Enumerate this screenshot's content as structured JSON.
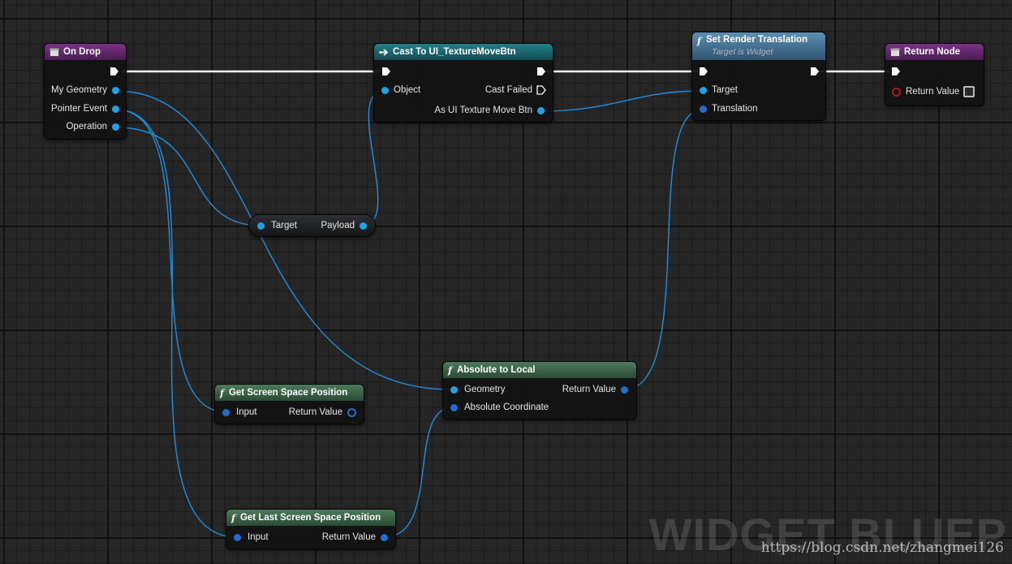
{
  "nodes": {
    "on_drop": {
      "title": "On Drop",
      "pins": [
        "My Geometry",
        "Pointer Event",
        "Operation"
      ]
    },
    "cast": {
      "title": "Cast To UI_TextureMoveBtn",
      "object": "Object",
      "cast_failed": "Cast Failed",
      "as_btn": "As UI Texture Move Btn"
    },
    "set_render": {
      "title": "Set Render Translation",
      "subtitle": "Target is Widget",
      "target": "Target",
      "translation": "Translation"
    },
    "return_node": {
      "title": "Return Node",
      "return_value": "Return Value"
    },
    "payload": {
      "target": "Target",
      "payload": "Payload"
    },
    "abs_to_local": {
      "title": "Absolute to Local",
      "geometry": "Geometry",
      "abs_coord": "Absolute Coordinate",
      "return_value": "Return Value"
    },
    "screen_pos": {
      "title": "Get Screen Space Position",
      "input": "Input",
      "return_value": "Return Value"
    },
    "last_screen_pos": {
      "title": "Get Last Screen Space Position",
      "input": "Input",
      "return_value": "Return Value"
    }
  },
  "watermark": {
    "title": "WIDGET BLUEP",
    "url": "https://blog.csdn.net/zhangmei126"
  },
  "colors": {
    "event_header": "#6a2a74",
    "cast_header": "#1c6870",
    "function_header": "#3e6a4a",
    "target_header": "#4e7a9a",
    "data_pin": "#1fa3e8",
    "exec_wire": "#ffffff"
  }
}
